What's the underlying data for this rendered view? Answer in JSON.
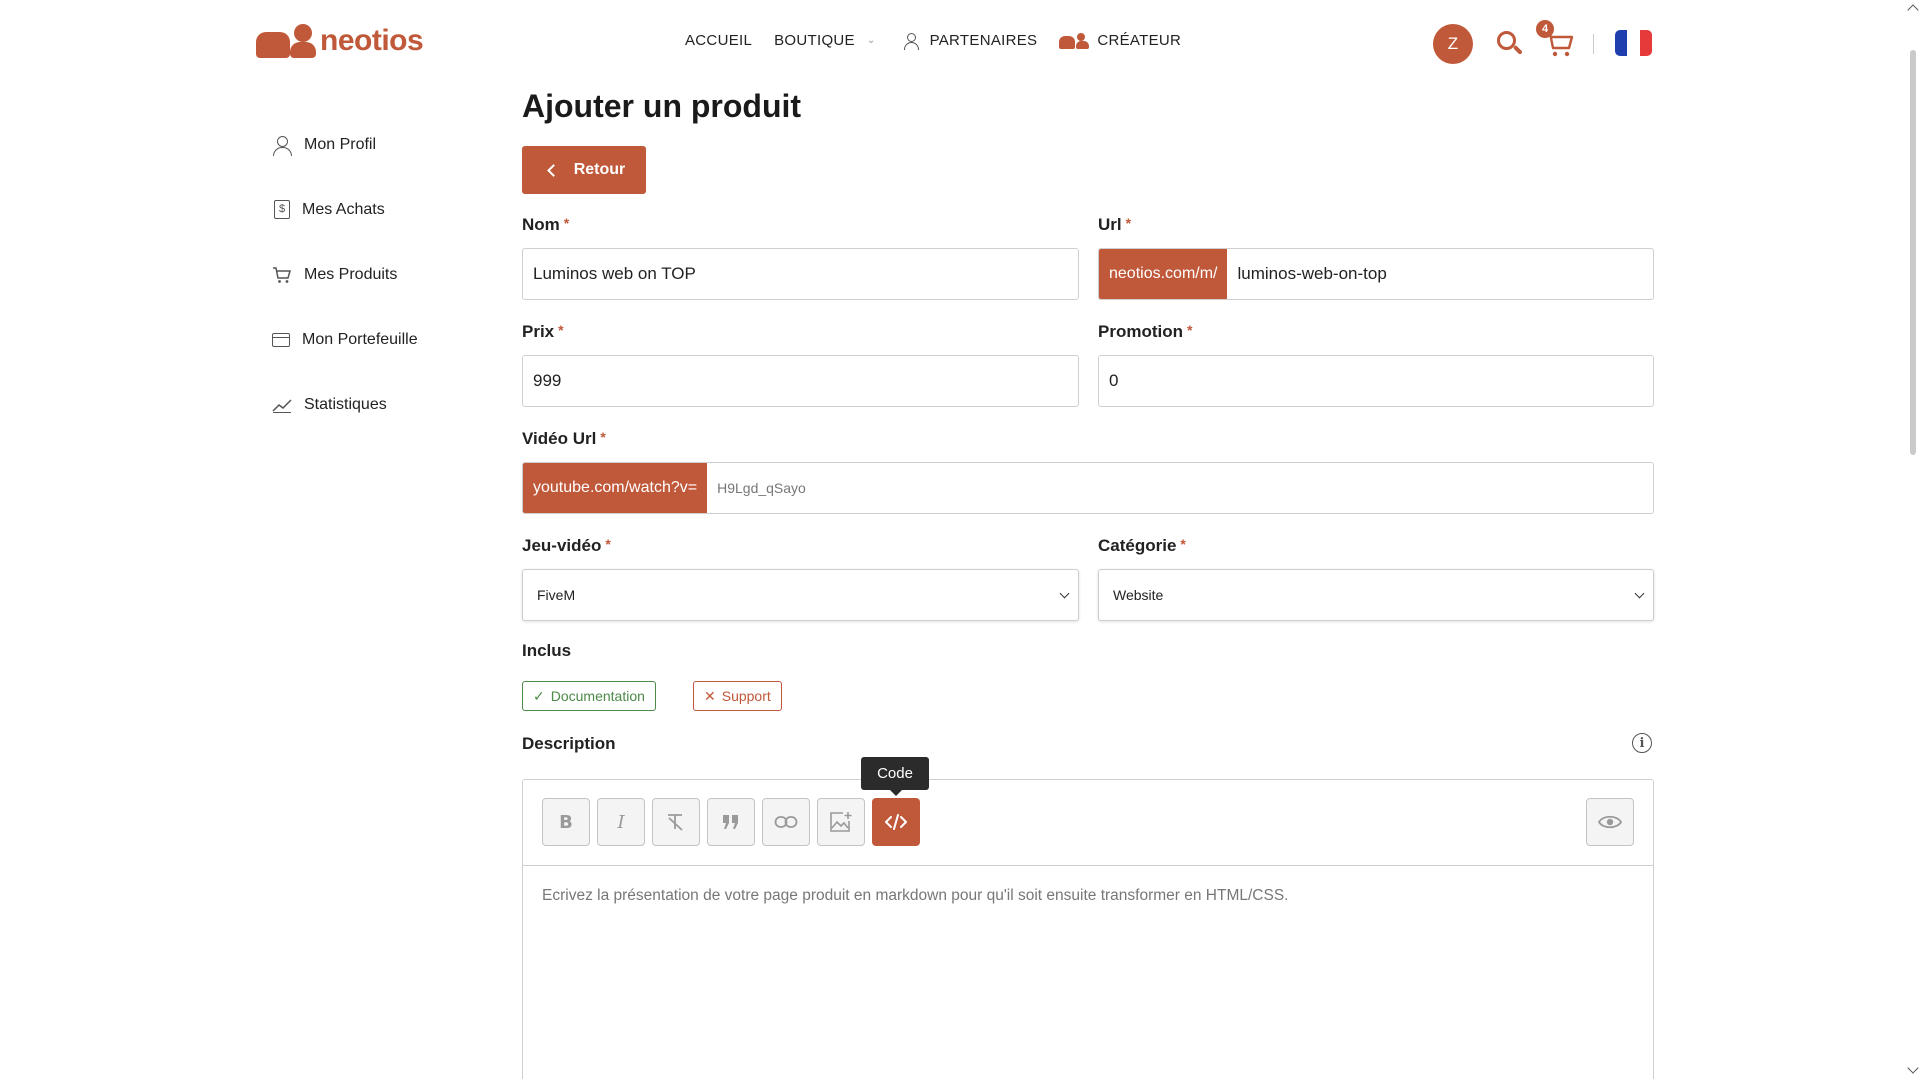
{
  "header": {
    "logo_text": "neotios",
    "nav": {
      "home": "ACCUEIL",
      "shop": "BOUTIQUE",
      "partners": "PARTENAIRES",
      "creator": "CRÉATEUR"
    },
    "avatar_initial": "Z",
    "cart_count": "4",
    "language_flag": "FR"
  },
  "sidebar": {
    "items": [
      {
        "label": "Mon Profil",
        "icon": "user-icon"
      },
      {
        "label": "Mes Achats",
        "icon": "receipt-icon"
      },
      {
        "label": "Mes Produits",
        "icon": "cart-icon"
      },
      {
        "label": "Mon Portefeuille",
        "icon": "wallet-icon"
      },
      {
        "label": "Statistiques",
        "icon": "chart-icon"
      }
    ]
  },
  "main": {
    "title": "Ajouter un produit",
    "back_label": "Retour",
    "fields": {
      "name": {
        "label": "Nom",
        "value": "Luminos web on TOP"
      },
      "url": {
        "label": "Url",
        "prefix": "neotios.com/m/",
        "value": "luminos-web-on-top"
      },
      "price": {
        "label": "Prix",
        "value": "999"
      },
      "promotion": {
        "label": "Promotion",
        "value": "0"
      },
      "video_url": {
        "label": "Vidéo Url",
        "prefix": "youtube.com/watch?v=",
        "placeholder": "H9Lgd_qSayo"
      },
      "game": {
        "label": "Jeu-vidéo",
        "value": "FiveM"
      },
      "category": {
        "label": "Catégorie",
        "value": "Website"
      }
    },
    "required_mark": "*",
    "included": {
      "label": "Inclus",
      "tags": [
        {
          "label": "Documentation",
          "state": "included",
          "symbol": "✓"
        },
        {
          "label": "Support",
          "state": "excluded",
          "symbol": "✕"
        }
      ]
    },
    "description": {
      "label": "Description",
      "tooltip": "Code",
      "toolbar": [
        "bold",
        "italic",
        "clear-format",
        "quote",
        "link",
        "image",
        "code"
      ],
      "placeholder": "Ecrivez la présentation de votre page produit en markdown pour qu'il soit ensuite transformer en HTML/CSS."
    }
  },
  "colors": {
    "accent": "#c0583a",
    "success": "#4c8a48",
    "text": "#222222",
    "border": "#cfcfcf"
  }
}
